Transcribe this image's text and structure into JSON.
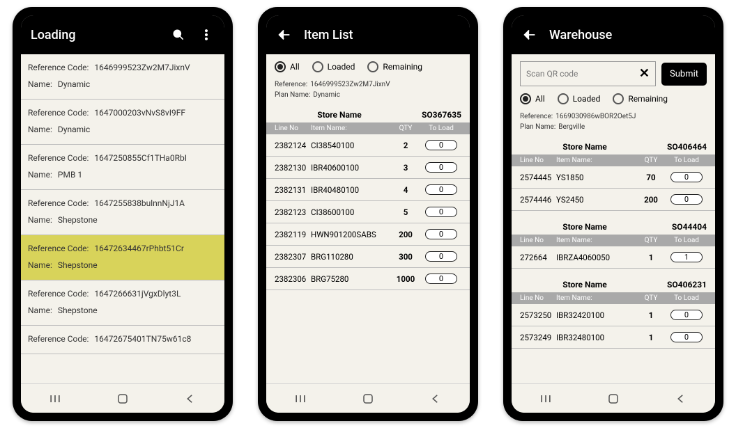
{
  "filters": {
    "all": "All",
    "loaded": "Loaded",
    "remaining": "Remaining"
  },
  "common_headers": {
    "line_no": "Line No",
    "item_name": "Item Name:",
    "qty": "QTY",
    "to_load": "To Load",
    "store_name": "Store Name"
  },
  "caption_labels": {
    "reference": "Reference:",
    "plan_name": "Plan Name:"
  },
  "phone1": {
    "title": "Loading",
    "item_labels": {
      "ref": "Reference Code:",
      "name": "Name:"
    },
    "items": [
      {
        "ref": "1646999523Zw2M7JixnV",
        "name": "Dynamic",
        "highlighted": false
      },
      {
        "ref": "1647000203vNvS8vI9FF",
        "name": "Dynamic",
        "highlighted": false
      },
      {
        "ref": "1647250855Cf1THa0RbI",
        "name": "PMB 1",
        "highlighted": false
      },
      {
        "ref": "1647255838bulnnNjJ1A",
        "name": "Shepstone",
        "highlighted": false
      },
      {
        "ref": "16472634467rPhbt51Cr",
        "name": "Shepstone",
        "highlighted": true
      },
      {
        "ref": "1647266631jVgxDlyt3L",
        "name": "Shepstone",
        "highlighted": false
      },
      {
        "ref": "16472675401TN75w61c8",
        "name": "",
        "highlighted": false
      }
    ]
  },
  "phone2": {
    "title": "Item List",
    "reference": "1646999523Zw2M7JixnV",
    "plan_name": "Dynamic",
    "selected_filter": "all",
    "store": {
      "title": "Store Name",
      "code": "SO367635"
    },
    "rows": [
      {
        "line": "2382124",
        "name": "CI38540100",
        "qty": "2",
        "to_load": "0"
      },
      {
        "line": "2382130",
        "name": "IBR40600100",
        "qty": "3",
        "to_load": "0"
      },
      {
        "line": "2382131",
        "name": "IBR40480100",
        "qty": "4",
        "to_load": "0"
      },
      {
        "line": "2382123",
        "name": "CI38600100",
        "qty": "5",
        "to_load": "0"
      },
      {
        "line": "2382119",
        "name": "HWN901200SABS",
        "qty": "200",
        "to_load": "0"
      },
      {
        "line": "2382307",
        "name": "BRG110280",
        "qty": "300",
        "to_load": "0"
      },
      {
        "line": "2382306",
        "name": "BRG75280",
        "qty": "1000",
        "to_load": "0"
      }
    ]
  },
  "phone3": {
    "title": "Warehouse",
    "scan_placeholder": "Scan QR code",
    "submit_label": "Submit",
    "reference": "1669030986wBOR2Oet5J",
    "plan_name": "Bergville",
    "selected_filter": "all",
    "sections": [
      {
        "store_code": "SO406464",
        "rows": [
          {
            "line": "2574445",
            "name": "YS1850",
            "qty": "70",
            "to_load": "0"
          },
          {
            "line": "2574446",
            "name": "YS2450",
            "qty": "200",
            "to_load": "0"
          }
        ]
      },
      {
        "store_code": "SO44404",
        "rows": [
          {
            "line": "272664",
            "name": "IBRZA4060050",
            "qty": "1",
            "to_load": "1"
          }
        ]
      },
      {
        "store_code": "SO406231",
        "rows": [
          {
            "line": "2573250",
            "name": "IBR32420100",
            "qty": "1",
            "to_load": "0"
          },
          {
            "line": "2573249",
            "name": "IBR32480100",
            "qty": "1",
            "to_load": "0"
          }
        ]
      }
    ]
  }
}
